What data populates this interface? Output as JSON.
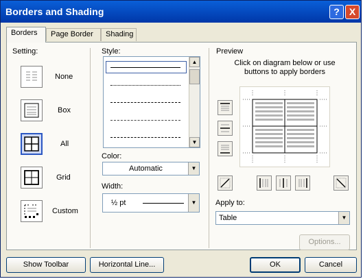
{
  "dialog": {
    "title": "Borders and Shading",
    "help_symbol": "?",
    "close_symbol": "X"
  },
  "tabs": [
    {
      "label": "Borders",
      "active": true
    },
    {
      "label": "Page Border",
      "active": false
    },
    {
      "label": "Shading",
      "active": false
    }
  ],
  "setting": {
    "label": "Setting:",
    "items": [
      {
        "label": "None",
        "selected": false
      },
      {
        "label": "Box",
        "selected": false
      },
      {
        "label": "All",
        "selected": true
      },
      {
        "label": "Grid",
        "selected": false
      },
      {
        "label": "Custom",
        "selected": false
      }
    ]
  },
  "style": {
    "label": "Style:",
    "line_styles": [
      "solid",
      "dotted",
      "dashed",
      "long-dashed",
      "dash-dot"
    ]
  },
  "color": {
    "label": "Color:",
    "value": "Automatic"
  },
  "width": {
    "label": "Width:",
    "value": "½ pt"
  },
  "preview": {
    "label": "Preview",
    "instructions": "Click on diagram below or use buttons to apply borders"
  },
  "apply_to": {
    "label": "Apply to:",
    "value": "Table"
  },
  "buttons": {
    "options": "Options...",
    "show_toolbar": "Show Toolbar",
    "horizontal_line": "Horizontal Line...",
    "ok": "OK",
    "cancel": "Cancel"
  },
  "colors": {
    "titlebar": "#0a5fd8",
    "dialog_bg": "#ece9d8",
    "selected_setting_border": "#2b57c3"
  }
}
